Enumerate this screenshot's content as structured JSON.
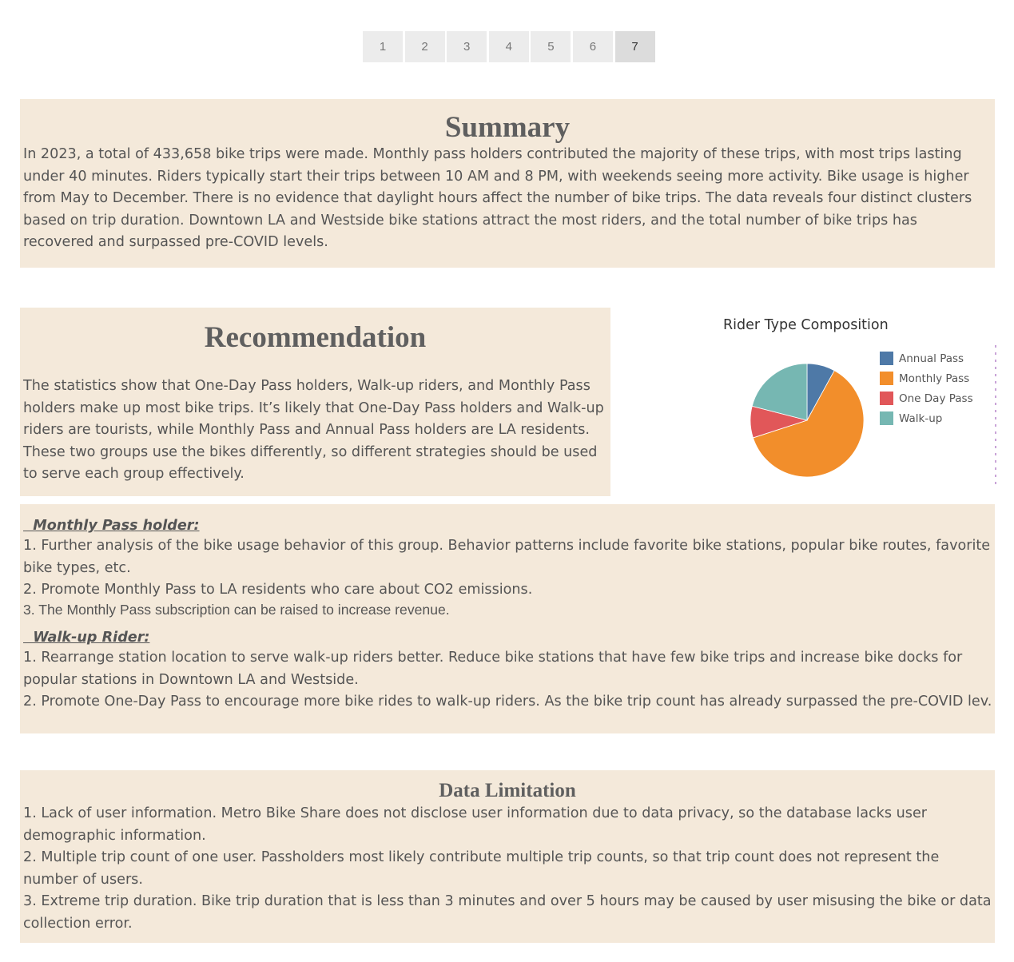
{
  "pagination": {
    "pages": [
      "1",
      "2",
      "3",
      "4",
      "5",
      "6",
      "7"
    ],
    "active": "7"
  },
  "summary": {
    "title": "Summary",
    "text": "In 2023, a total of 433,658 bike trips were made. Monthly pass holders contributed the majority of these trips, with most trips lasting under 40 minutes. Riders typically start their trips between 10 AM and 8 PM, with weekends seeing more activity. Bike usage is higher from May to December. There is no evidence that daylight hours affect the number of bike trips. The data reveals four distinct clusters based on trip duration. Downtown LA and Westside bike stations attract the most riders, and the total number of bike trips has recovered and surpassed pre-COVID levels."
  },
  "recommendation": {
    "title": "Recommendation",
    "text": "The statistics show that One-Day Pass holders, Walk-up riders, and Monthly Pass holders make up most bike trips. It’s likely that One-Day Pass holders and Walk-up riders are tourists, while Monthly Pass and Annual Pass holders are LA residents. These two groups use the bikes differently, so different strategies should be used to serve each group effectively."
  },
  "chart_data": {
    "type": "pie",
    "title": "Rider Type Composition",
    "categories": [
      "Annual Pass",
      "Monthly Pass",
      "One Day Pass",
      "Walk-up"
    ],
    "values": [
      8,
      62,
      9,
      21
    ],
    "colors": [
      "#4e79a7",
      "#f28e2b",
      "#e15759",
      "#76b7b2"
    ],
    "legend": "right"
  },
  "details": {
    "monthly": {
      "heading": "  Monthly Pass holder:",
      "item1": "1. Further analysis of the bike usage behavior of this group. Behavior patterns include favorite bike stations, popular bike routes, favorite bike types, etc.",
      "item2": "2. Promote Monthly Pass to LA residents who care about CO2 emissions.",
      "item3": "3. The Monthly Pass subscription can be raised to increase revenue."
    },
    "walkup": {
      "heading": "  Walk-up Rider:",
      "item1": "1. Rearrange station location to serve walk-up riders better. Reduce bike stations that have few bike trips and increase bike docks for popular stations in Downtown LA and Westside.",
      "item2": "2. Promote One-Day Pass to encourage more bike rides to walk-up riders. As the bike trip count has already surpassed the pre-COVID lev.."
    }
  },
  "limitation": {
    "title": "Data Limitation",
    "item1": "1. Lack of user information. Metro Bike Share does not disclose user information due to data privacy, so the database lacks user demographic information.",
    "item2": "2. Multiple trip count of one user. Passholders most likely contribute multiple trip counts, so that trip count does not represent the number of users.",
    "item3": "3. Extreme trip duration. Bike trip duration that is less than 3 minutes and over 5 hours may be caused by user misusing the bike or data collection error."
  }
}
